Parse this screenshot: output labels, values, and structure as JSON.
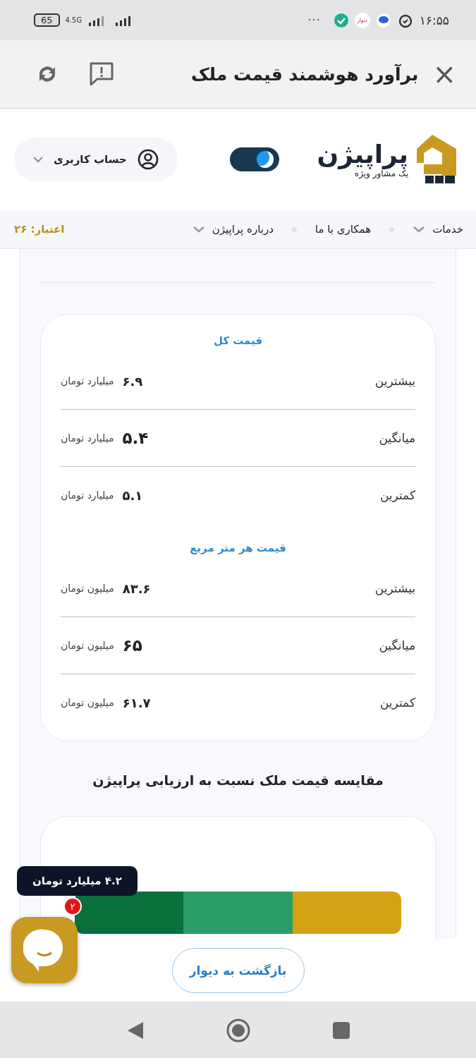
{
  "status_bar": {
    "time": "۱۶:۵۵",
    "battery": "65",
    "network": "4.5G",
    "more": "···",
    "app_badge": "دیوار"
  },
  "app_bar": {
    "title": "برآورد هوشمند قیمت ملک",
    "close": "×"
  },
  "site_header": {
    "logo_name": "پراپیژن",
    "logo_tagline": "یک مشاور ویژه",
    "dark_mode": {
      "on": true
    },
    "account": "حساب کاربری"
  },
  "nav": {
    "items": [
      {
        "label": "خدمات",
        "dropdown": true
      },
      {
        "label": "همکاری با ما",
        "dropdown": false
      },
      {
        "label": "درباره پراپیژن",
        "dropdown": true
      }
    ],
    "credit": "اعتبار: ۲۶"
  },
  "price_card": {
    "sections": [
      {
        "title": "قیمت کل",
        "rows": [
          {
            "label": "بیشترین",
            "value": "۶.۹",
            "unit": "میلیارد تومان",
            "highlight": false
          },
          {
            "label": "میانگین",
            "value": "۵.۴",
            "unit": "میلیارد تومان",
            "highlight": true
          },
          {
            "label": "کمترین",
            "value": "۵.۱",
            "unit": "میلیارد تومان",
            "highlight": false
          }
        ]
      },
      {
        "title": "قیمت هر متر مربع",
        "rows": [
          {
            "label": "بیشترین",
            "value": "۸۳.۶",
            "unit": "میلیون تومان",
            "highlight": false
          },
          {
            "label": "میانگین",
            "value": "۶۵",
            "unit": "میلیون تومان",
            "highlight": true
          },
          {
            "label": "کمترین",
            "value": "۶۱.۷",
            "unit": "میلیون تومان",
            "highlight": false
          }
        ]
      }
    ]
  },
  "comparison": {
    "title": "مقایسه قیمت ملک نسبت به ارزیابی پراپیژن",
    "tooltip": "۴.۲ میلیارد تومان",
    "segments": [
      {
        "color": "#d4a214"
      },
      {
        "color": "#2a9d68"
      },
      {
        "color": "#07703c"
      }
    ]
  },
  "chat": {
    "badge": "۲"
  },
  "back_button": "بازگشت به دیوار"
}
